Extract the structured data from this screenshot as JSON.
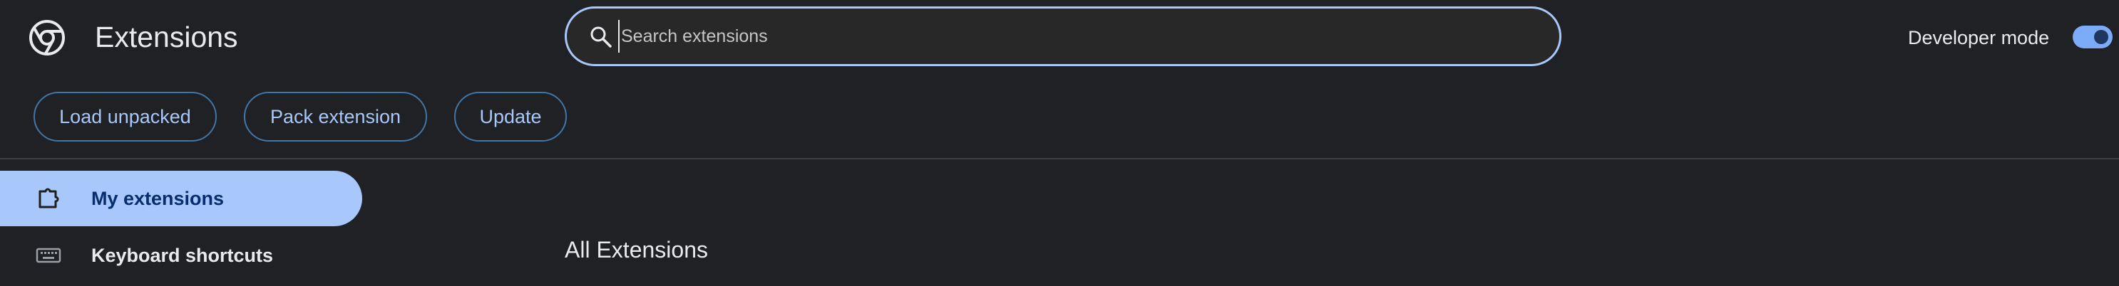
{
  "header": {
    "title": "Extensions",
    "logo_icon": "chrome-logo-icon",
    "search": {
      "placeholder": "Search extensions",
      "value": "",
      "icon": "search-icon"
    },
    "developer_mode": {
      "label": "Developer mode",
      "enabled": true
    }
  },
  "toolbar": {
    "load_unpacked_label": "Load unpacked",
    "pack_extension_label": "Pack extension",
    "update_label": "Update"
  },
  "sidebar": {
    "items": [
      {
        "label": "My extensions",
        "icon": "puzzle-piece-icon",
        "selected": true
      },
      {
        "label": "Keyboard shortcuts",
        "icon": "keyboard-icon",
        "selected": false
      }
    ]
  },
  "main": {
    "section_heading": "All Extensions"
  },
  "colors": {
    "background": "#202124",
    "accent": "#a8c7fa",
    "toggle_on": "#7cacf8",
    "button_border": "#3f77a8",
    "divider": "#3c4043"
  }
}
